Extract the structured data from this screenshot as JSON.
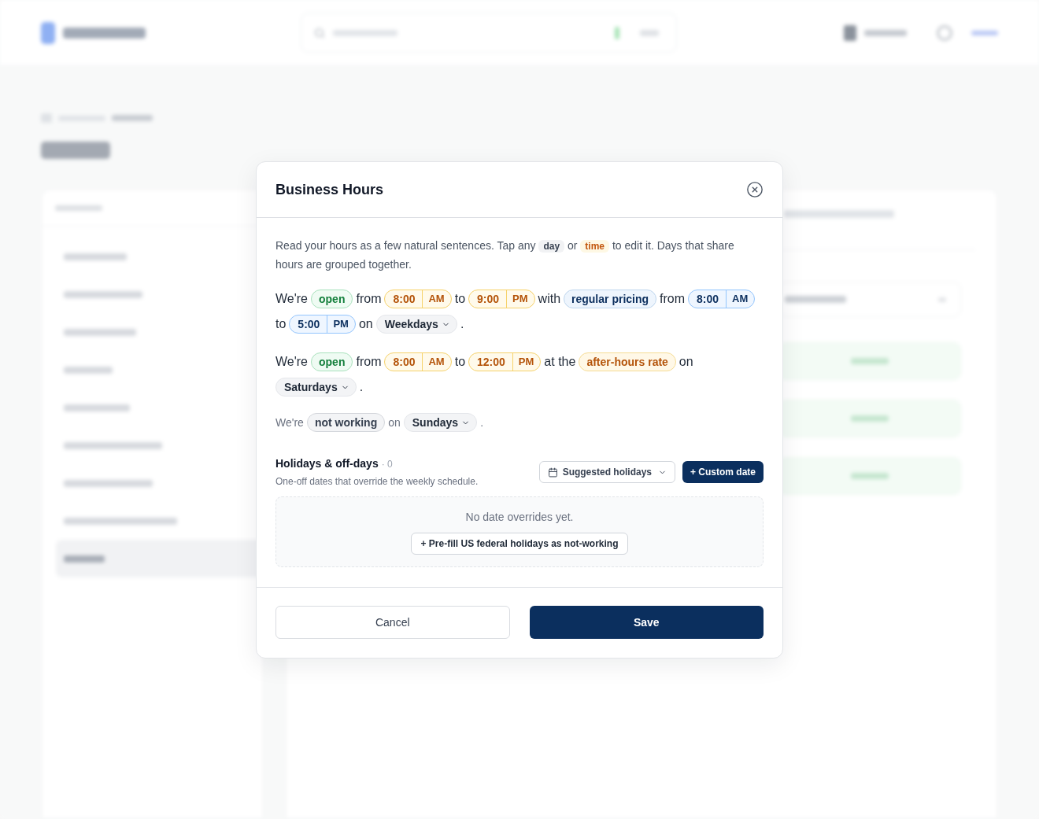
{
  "background": {
    "sidebar_items": [
      {
        "selected": false
      },
      {
        "selected": false
      },
      {
        "selected": false
      },
      {
        "selected": false
      },
      {
        "selected": false
      },
      {
        "selected": false
      },
      {
        "selected": false
      },
      {
        "selected": false
      },
      {
        "selected": true
      }
    ]
  },
  "modal": {
    "title": "Business Hours",
    "intro": [
      {
        "kind": "plain",
        "text": "Read your hours as a few natural sentences. Tap any"
      },
      {
        "kind": "day",
        "text": "day"
      },
      {
        "kind": "plain",
        "text": "or"
      },
      {
        "kind": "hours",
        "text": "time"
      },
      {
        "kind": "plain",
        "text": "to edit it. Days that share hours are grouped together."
      }
    ],
    "rules": [
      {
        "open": true,
        "segments": [
          {
            "kind": "word",
            "text": "We're"
          },
          {
            "kind": "status",
            "text": "open"
          },
          {
            "kind": "word",
            "text": "from"
          },
          {
            "kind": "hours",
            "time": "8:00",
            "period": "AM"
          },
          {
            "kind": "word",
            "text": "to"
          },
          {
            "kind": "hours",
            "time": "9:00",
            "period": "PM"
          },
          {
            "kind": "word",
            "text": "with"
          },
          {
            "kind": "pricing",
            "text": "regular pricing"
          },
          {
            "kind": "word",
            "text": "from"
          },
          {
            "kind": "window",
            "time": "8:00",
            "period": "AM"
          },
          {
            "kind": "word",
            "text": "to"
          },
          {
            "kind": "window",
            "time": "5:00",
            "period": "PM"
          },
          {
            "kind": "word",
            "text": "on"
          },
          {
            "kind": "day",
            "text": "Weekdays"
          },
          {
            "kind": "word",
            "text": "."
          }
        ]
      },
      {
        "open": true,
        "segments": [
          {
            "kind": "word",
            "text": "We're"
          },
          {
            "kind": "status",
            "text": "open"
          },
          {
            "kind": "word",
            "text": "from"
          },
          {
            "kind": "hours",
            "time": "8:00",
            "period": "AM"
          },
          {
            "kind": "word",
            "text": "to"
          },
          {
            "kind": "hours",
            "time": "12:00",
            "period": "PM"
          },
          {
            "kind": "word",
            "text": "at the"
          },
          {
            "kind": "rate",
            "text": "after-hours rate"
          },
          {
            "kind": "word",
            "text": "on"
          },
          {
            "kind": "day",
            "text": "Saturdays"
          },
          {
            "kind": "word",
            "text": "."
          }
        ]
      },
      {
        "open": false,
        "segments": [
          {
            "kind": "word",
            "text": "We're"
          },
          {
            "kind": "status",
            "text": "not working"
          },
          {
            "kind": "word",
            "text": "on"
          },
          {
            "kind": "day",
            "text": "Sundays"
          },
          {
            "kind": "word",
            "text": "."
          }
        ]
      }
    ],
    "holidays": {
      "title": "Holidays & off-days",
      "count": "· 0",
      "subtitle": "One-off dates that override the weekly schedule.",
      "suggested_button": "Suggested holidays",
      "custom_button": "+ Custom date",
      "empty_text": "No date overrides yet.",
      "prefill_button": "+ Pre-fill US federal holidays as not-working"
    },
    "buttons": {
      "cancel": "Cancel",
      "save": "Save"
    }
  }
}
